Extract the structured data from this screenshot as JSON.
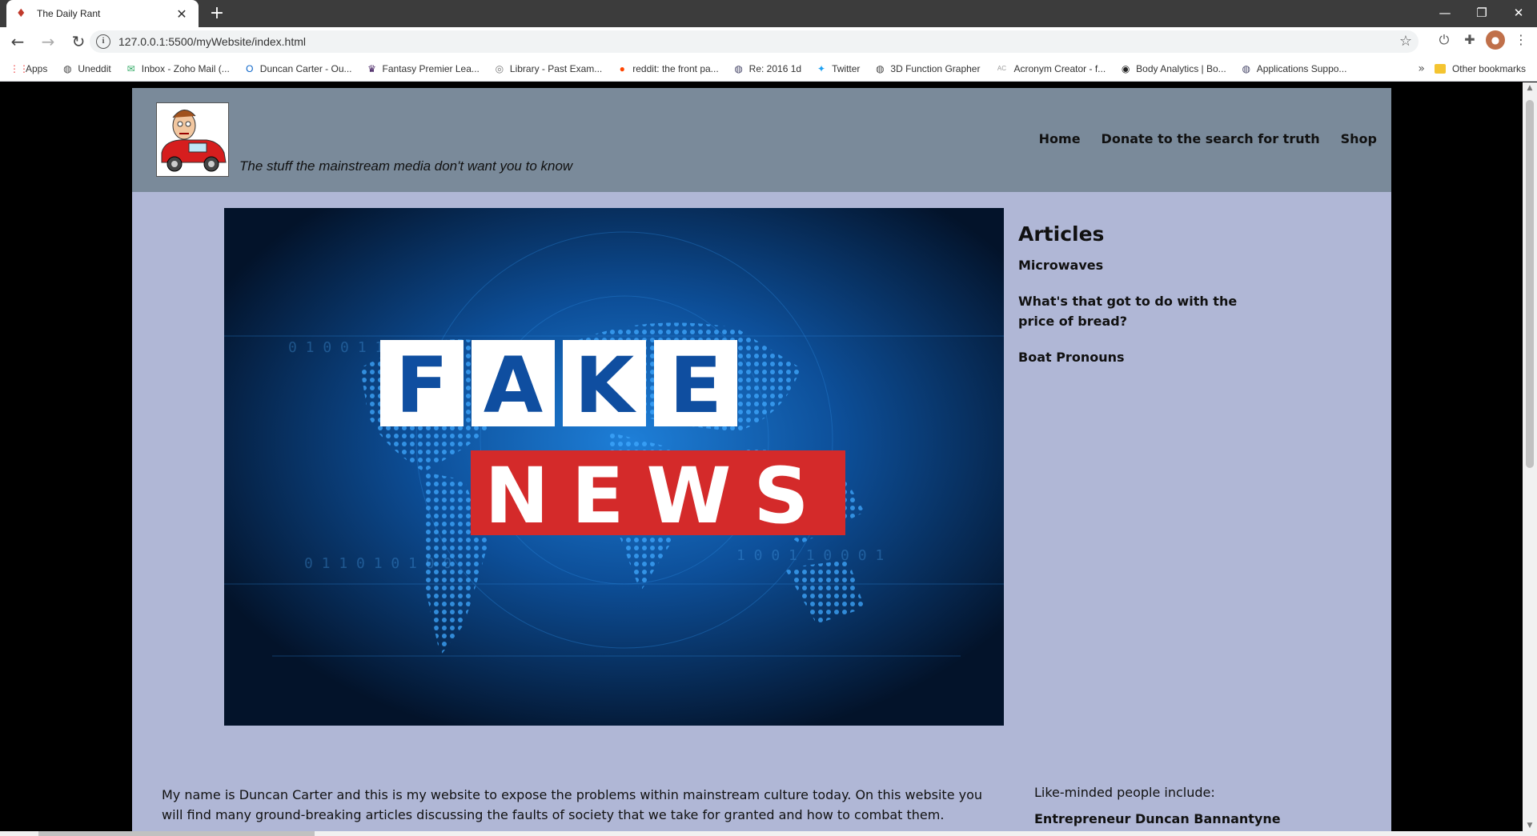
{
  "browser": {
    "tab_title": "The Daily Rant",
    "url": "127.0.0.1:5500/myWebsite/index.html",
    "bookmarks": [
      {
        "label": "Apps",
        "icon": "apps-grid-icon",
        "color": "#e44"
      },
      {
        "label": "Uneddit",
        "icon": "globe-icon",
        "color": "#444"
      },
      {
        "label": "Inbox - Zoho Mail (...",
        "icon": "mail-icon",
        "color": "#3a6"
      },
      {
        "label": "Duncan Carter - Ou...",
        "icon": "outlook-icon",
        "color": "#0a64c8"
      },
      {
        "label": "Fantasy Premier Lea...",
        "icon": "premier-league-icon",
        "color": "#3d185b"
      },
      {
        "label": "Library - Past Exam...",
        "icon": "library-icon",
        "color": "#777"
      },
      {
        "label": "reddit: the front pa...",
        "icon": "reddit-icon",
        "color": "#ff4500"
      },
      {
        "label": "Re: 2016 1d",
        "icon": "globe-icon",
        "color": "#446"
      },
      {
        "label": "Twitter",
        "icon": "twitter-icon",
        "color": "#1da1f2"
      },
      {
        "label": "3D Function Grapher",
        "icon": "globe-icon",
        "color": "#444"
      },
      {
        "label": "Acronym Creator - f...",
        "icon": "acronym-icon",
        "color": "#999"
      },
      {
        "label": "Body Analytics | Bo...",
        "icon": "body-analytics-icon",
        "color": "#222"
      },
      {
        "label": "Applications Suppo...",
        "icon": "globe-icon",
        "color": "#446"
      }
    ],
    "other_bookmarks": "Other bookmarks"
  },
  "site": {
    "tagline": "The stuff the mainstream media don't want you to know",
    "nav": [
      "Home",
      "Donate to the search for truth",
      "Shop"
    ],
    "hero": {
      "word1": [
        "F",
        "A",
        "K",
        "E"
      ],
      "word2": "NEWS"
    },
    "sidebar": {
      "heading": "Articles",
      "articles": [
        "Microwaves",
        "What's that got to do with the price of bread?",
        "Boat Pronouns"
      ]
    },
    "intro": "My name is Duncan Carter and this is my website to expose the problems within mainstream culture today. On this website you will find many ground-breaking articles discussing the faults of society that we take for granted and how to combat them.",
    "likeminded": {
      "label": "Like-minded people include:",
      "first_name": "Entrepreneur Duncan Bannantyne"
    }
  },
  "colors": {
    "header_bg": "#7a8a9a",
    "page_bg": "#b0b7d6",
    "fake_news_red": "#d42a2a"
  }
}
